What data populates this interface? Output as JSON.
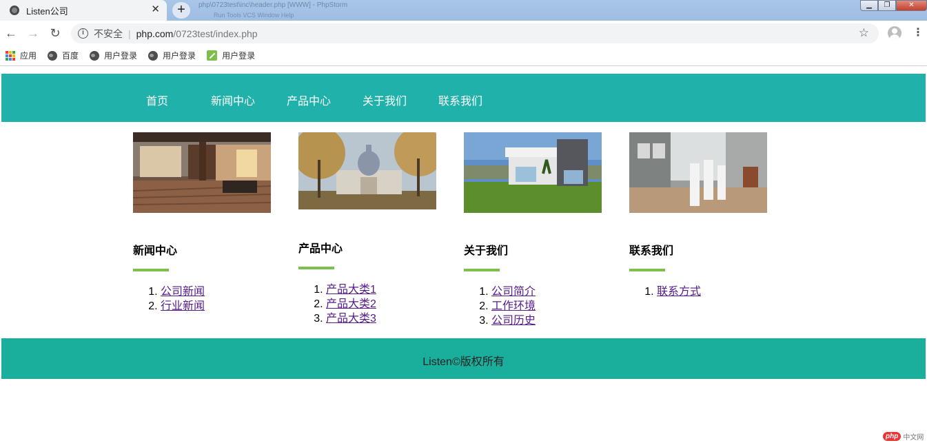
{
  "browser": {
    "tab_title": "Listen公司",
    "tab_close": "✕",
    "new_tab": "+",
    "background_window_text": "php\\0723test\\inc\\header.php [WWW] - PhpStorm",
    "background_window_menu": "Run   Tools   VCS   Window   Help",
    "security_label": "不安全",
    "url_host": "php.com",
    "url_path": "/0723test/index.php",
    "bookmarks": [
      {
        "label": "应用",
        "icon": "apps-icon"
      },
      {
        "label": "百度",
        "icon": "globe-icon"
      },
      {
        "label": "用户登录",
        "icon": "globe-icon"
      },
      {
        "label": "用户登录",
        "icon": "globe-icon"
      },
      {
        "label": "用户登录",
        "icon": "leaf-icon"
      }
    ]
  },
  "site": {
    "nav": [
      "首页",
      "新闻中心",
      "产品中心",
      "关于我们",
      "联系我们"
    ],
    "sections": [
      {
        "heading": "新闻中心",
        "links": [
          "公司新闻",
          "行业新闻"
        ],
        "image": "house-terrace-photo"
      },
      {
        "heading": "产品中心",
        "links": [
          "产品大类1",
          "产品大类2",
          "产品大类3"
        ],
        "image": "exhibition-building-photo"
      },
      {
        "heading": "关于我们",
        "links": [
          "公司简介",
          "工作环境",
          "公司历史"
        ],
        "image": "modern-villa-photo"
      },
      {
        "heading": "联系我们",
        "links": [
          "联系方式"
        ],
        "image": "empty-gallery-room-photo"
      }
    ],
    "footer": "Listen©版权所有"
  },
  "watermark": {
    "logo": "php",
    "text": "中文网"
  },
  "colors": {
    "nav": "#20b2aa",
    "footer": "#1aaf9c",
    "accent_underline": "#7cbf4c",
    "link": "#551a8b"
  }
}
